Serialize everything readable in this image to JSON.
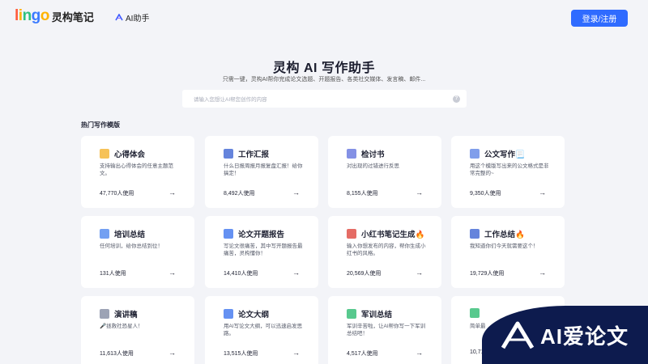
{
  "header": {
    "logo_letters": [
      "l",
      "i",
      "n",
      "g",
      "o"
    ],
    "logo_cn": "灵构笔记",
    "ai_helper_label": "AI助手",
    "login_label": "登录/注册"
  },
  "hero": {
    "title": "灵构 AI 写作助手",
    "subtitle": "只需一键，灵构AI帮你完成论文选题、开题报告、各类社交媒体、发言稿、邮件...",
    "search_placeholder": "请输入您想让AI帮您创作的内容",
    "help_icon": "?"
  },
  "section_title": "热门写作模版",
  "arrow_glyph": "→",
  "cards": [
    {
      "title": "心得体会",
      "icon": "note-icon",
      "icon_color": "#f5b73b",
      "desc": "支持输出心得体会的任意主题范文。",
      "usage": "47,770人使用"
    },
    {
      "title": "工作汇报",
      "icon": "briefcase-icon",
      "icon_color": "#4a6fd6",
      "desc": "什么日报周报月报复盘汇报！给你搞定！",
      "usage": "8,492人使用"
    },
    {
      "title": "检讨书",
      "icon": "pencil-icon",
      "icon_color": "#6e7ee0",
      "desc": "对出现的过错进行反思",
      "usage": "8,155人使用"
    },
    {
      "title": "公文写作📃",
      "icon": "document-icon",
      "icon_color": "#6a8de8",
      "desc": "用这个模版写出来的公文格式是非常完整的~",
      "usage": "9,350人使用"
    },
    {
      "title": "培训总结",
      "icon": "chat-icon",
      "icon_color": "#5b8ff0",
      "desc": "任何培训，给你总结到位！",
      "usage": "131人使用"
    },
    {
      "title": "论文开题报告",
      "icon": "report-icon",
      "icon_color": "#4a7ef0",
      "desc": "写论文很痛苦，其中写开题报告最痛苦，灵构懂你！",
      "usage": "14,410人使用"
    },
    {
      "title": "小红书笔记生成🔥",
      "icon": "book-icon",
      "icon_color": "#e0524a",
      "desc": "输入你想发布的内容，帮你生成小红书的风格。",
      "usage": "20,569人使用"
    },
    {
      "title": "工作总结🔥",
      "icon": "toolbox-icon",
      "icon_color": "#4a6fd6",
      "desc": "我知道你们今天就需要这个！",
      "usage": "19,729人使用"
    },
    {
      "title": "演讲稿",
      "icon": "microphone-icon",
      "icon_color": "#8b93a8",
      "desc": "🎤拯救社恐星人！",
      "usage": "11,613人使用"
    },
    {
      "title": "论文大纲",
      "icon": "outline-icon",
      "icon_color": "#4a7ef0",
      "desc": "用AI写论文大纲，可以迅速启发思路。",
      "usage": "13,515人使用"
    },
    {
      "title": "军训总结",
      "icon": "military-icon",
      "icon_color": "#3bbf7a",
      "desc": "军训辛苦啦，让AI帮你写一下军训总结吧！",
      "usage": "4,517人使用"
    },
    {
      "title": "",
      "icon": "megaphone-icon",
      "icon_color": "#3bbf7a",
      "desc": "简单最",
      "usage": "10,71"
    }
  ],
  "watermark": {
    "text": "AI爱论文"
  }
}
